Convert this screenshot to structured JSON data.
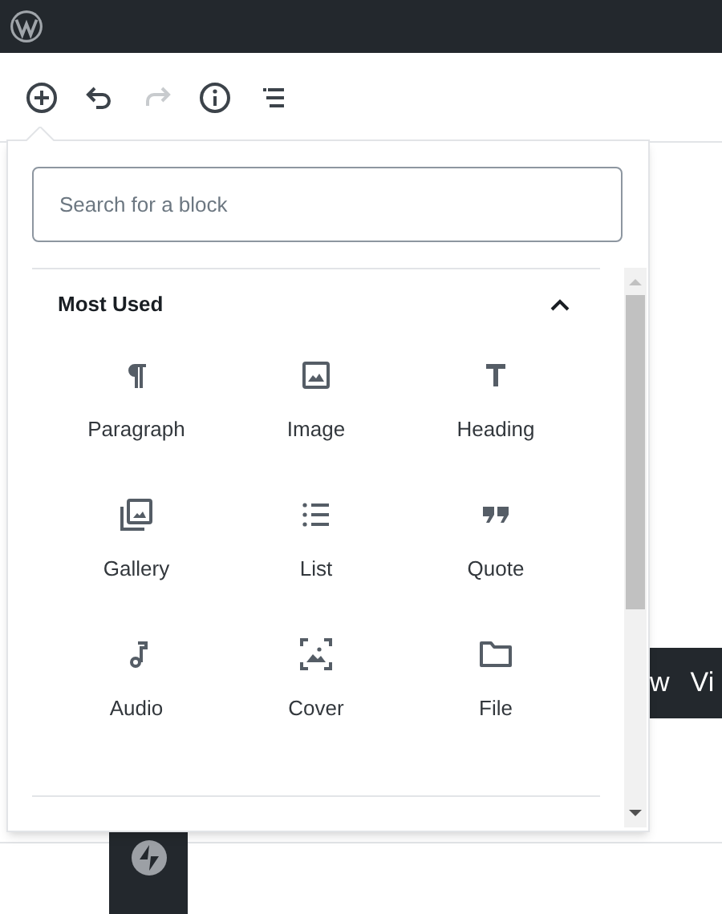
{
  "toolbar": [
    {
      "kind": "inserter",
      "disabled": false
    },
    {
      "kind": "undo",
      "disabled": false
    },
    {
      "kind": "redo",
      "disabled": true
    },
    {
      "kind": "info",
      "disabled": false
    },
    {
      "kind": "outline",
      "disabled": false
    }
  ],
  "inserter": {
    "search": {
      "placeholder": "Search for a block"
    },
    "section": {
      "title": "Most Used",
      "expanded": true,
      "blocks": [
        {
          "kind": "paragraph",
          "label": "Paragraph"
        },
        {
          "kind": "image",
          "label": "Image"
        },
        {
          "kind": "heading",
          "label": "Heading"
        },
        {
          "kind": "gallery",
          "label": "Gallery"
        },
        {
          "kind": "list",
          "label": "List"
        },
        {
          "kind": "quote",
          "label": "Quote"
        },
        {
          "kind": "audio",
          "label": "Audio"
        },
        {
          "kind": "cover",
          "label": "Cover"
        },
        {
          "kind": "file",
          "label": "File"
        }
      ]
    }
  },
  "background_toolbar": [
    "w",
    "Vi"
  ]
}
